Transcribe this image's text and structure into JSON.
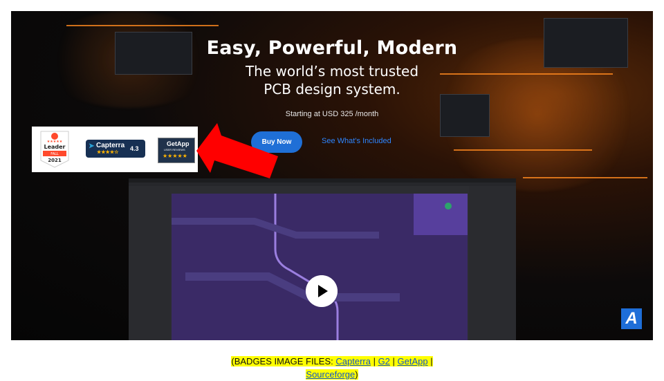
{
  "hero": {
    "headline": "Easy, Powerful, Modern",
    "subhead_line1": "The world’s most trusted",
    "subhead_line2": "PCB design system.",
    "price_text": "Starting at USD 325 /month",
    "buy_label": "Buy Now",
    "see_label": "See What’s Included",
    "logo_letter": "A"
  },
  "badges": {
    "g2_line1": "Leader",
    "g2_line2": "FALL",
    "g2_line3": "2021",
    "capterra_label": "Capterra",
    "capterra_score": "4.3",
    "getapp_label": "GetApp",
    "getapp_sub": "USER REVIEWS"
  },
  "caption": {
    "prefix": "(BADGES IMAGE FILES: ",
    "links": [
      "Capterra",
      "G2",
      "GetApp",
      "Sourceforge"
    ],
    "sep": " | ",
    "suffix": ")"
  },
  "colors": {
    "accent": "#1f6fd6",
    "link": "#2e86ff",
    "arrow": "#ff0000",
    "highlight": "#ffff00"
  }
}
